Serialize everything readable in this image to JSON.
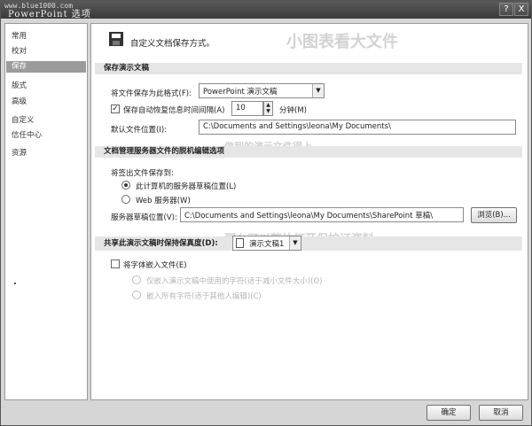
{
  "window": {
    "watermark": "www.blue1000.com",
    "title": "PowerPoint 选项",
    "help_glyph": "?",
    "close_glyph": "X"
  },
  "sidebar": {
    "items": [
      {
        "label": "常用"
      },
      {
        "label": "校对"
      },
      {
        "label": "保存",
        "selected": true
      },
      {
        "label": "版式"
      },
      {
        "label": "高级"
      },
      {
        "label": "自定义"
      },
      {
        "label": "信任中心"
      },
      {
        "label": "资源"
      }
    ]
  },
  "header": {
    "icon": "save-icon",
    "text": "自定义文档保存方式。"
  },
  "sections": {
    "save_presentation": {
      "title": "保存演示文稿",
      "format_label": "将文件保存为此格式(F):",
      "format_value": "PowerPoint 演示文稿",
      "autorecover_label": "保存自动恢复信息时间间隔(A)",
      "autorecover_checked": true,
      "autorecover_value": "10",
      "minutes_label": "分钟(M)",
      "default_location_label": "默认文件位置(I):",
      "default_location_value": "C:\\Documents and Settings\\leona\\My Documents\\"
    },
    "offline": {
      "title": "文档管理服务器文件的脱机编辑选项",
      "save_to_label": "将签出文件保存到:",
      "radio_local": "此计算机的服务器草稿位置(L)",
      "radio_local_selected": true,
      "radio_web": "Web 服务器(W)",
      "drafts_label": "服务器草稿位置(V):",
      "drafts_value": "C:\\Documents and Settings\\leona\\My Documents\\SharePoint 草稿\\",
      "browse_label": "浏览(B)..."
    },
    "fidelity": {
      "title": "共享此演示文稿时保持保真度(D):",
      "doc_value": "演示文稿1",
      "embed_label": "将字体嵌入文件(E)",
      "embed_checked": false,
      "option1": "仅嵌入演示文稿中使用的字符(适于减小文件大小)(O)",
      "option2": "嵌入所有字符(适于其他人编辑)(C)"
    }
  },
  "footer": {
    "ok_label": "确定",
    "cancel_label": "取消"
  },
  "ghost_text": {
    "line1": "小图表看大文件",
    "line2": "做到的演示文件得上",
    "line3": "那么可以整体打开保护证资料"
  }
}
